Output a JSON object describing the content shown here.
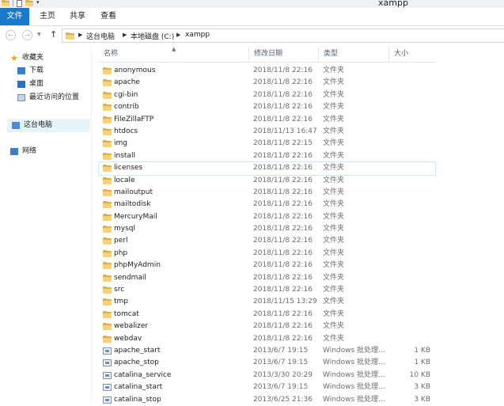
{
  "window": {
    "title": "xampp"
  },
  "ribbon": {
    "tabs": [
      {
        "label": "文件"
      },
      {
        "label": "主页"
      },
      {
        "label": "共享"
      },
      {
        "label": "查看"
      }
    ]
  },
  "address": {
    "crumbs": [
      "这台电脑",
      "本地磁盘 (C:)",
      "xampp"
    ]
  },
  "navpane": {
    "favorites": "收藏夹",
    "downloads": "下载",
    "desktop": "桌面",
    "recent": "最近访问的位置",
    "this_pc": "这台电脑",
    "network": "网络"
  },
  "columns": {
    "name": "名称",
    "date": "修改日期",
    "type": "类型",
    "size": "大小"
  },
  "files": [
    {
      "name": "anonymous",
      "date": "2018/11/8 22:16",
      "type": "文件夹",
      "size": "",
      "kind": "folder"
    },
    {
      "name": "apache",
      "date": "2018/11/8 22:16",
      "type": "文件夹",
      "size": "",
      "kind": "folder"
    },
    {
      "name": "cgi-bin",
      "date": "2018/11/8 22:16",
      "type": "文件夹",
      "size": "",
      "kind": "folder"
    },
    {
      "name": "contrib",
      "date": "2018/11/8 22:16",
      "type": "文件夹",
      "size": "",
      "kind": "folder"
    },
    {
      "name": "FileZillaFTP",
      "date": "2018/11/8 22:16",
      "type": "文件夹",
      "size": "",
      "kind": "folder"
    },
    {
      "name": "htdocs",
      "date": "2018/11/13 16:47",
      "type": "文件夹",
      "size": "",
      "kind": "folder"
    },
    {
      "name": "img",
      "date": "2018/11/8 22:15",
      "type": "文件夹",
      "size": "",
      "kind": "folder"
    },
    {
      "name": "install",
      "date": "2018/11/8 22:16",
      "type": "文件夹",
      "size": "",
      "kind": "folder"
    },
    {
      "name": "licenses",
      "date": "2018/11/8 22:16",
      "type": "文件夹",
      "size": "",
      "kind": "folder",
      "highlight": true
    },
    {
      "name": "locale",
      "date": "2018/11/8 22:16",
      "type": "文件夹",
      "size": "",
      "kind": "folder"
    },
    {
      "name": "mailoutput",
      "date": "2018/11/8 22:16",
      "type": "文件夹",
      "size": "",
      "kind": "folder"
    },
    {
      "name": "mailtodisk",
      "date": "2018/11/8 22:16",
      "type": "文件夹",
      "size": "",
      "kind": "folder"
    },
    {
      "name": "MercuryMail",
      "date": "2018/11/8 22:16",
      "type": "文件夹",
      "size": "",
      "kind": "folder"
    },
    {
      "name": "mysql",
      "date": "2018/11/8 22:16",
      "type": "文件夹",
      "size": "",
      "kind": "folder"
    },
    {
      "name": "perl",
      "date": "2018/11/8 22:16",
      "type": "文件夹",
      "size": "",
      "kind": "folder"
    },
    {
      "name": "php",
      "date": "2018/11/8 22:16",
      "type": "文件夹",
      "size": "",
      "kind": "folder"
    },
    {
      "name": "phpMyAdmin",
      "date": "2018/11/8 22:16",
      "type": "文件夹",
      "size": "",
      "kind": "folder"
    },
    {
      "name": "sendmail",
      "date": "2018/11/8 22:16",
      "type": "文件夹",
      "size": "",
      "kind": "folder"
    },
    {
      "name": "src",
      "date": "2018/11/8 22:16",
      "type": "文件夹",
      "size": "",
      "kind": "folder"
    },
    {
      "name": "tmp",
      "date": "2018/11/15 13:29",
      "type": "文件夹",
      "size": "",
      "kind": "folder"
    },
    {
      "name": "tomcat",
      "date": "2018/11/8 22:16",
      "type": "文件夹",
      "size": "",
      "kind": "folder"
    },
    {
      "name": "webalizer",
      "date": "2018/11/8 22:16",
      "type": "文件夹",
      "size": "",
      "kind": "folder"
    },
    {
      "name": "webdav",
      "date": "2018/11/8 22:16",
      "type": "文件夹",
      "size": "",
      "kind": "folder"
    },
    {
      "name": "apache_start",
      "date": "2013/6/7 19:15",
      "type": "Windows 批处理...",
      "size": "1 KB",
      "kind": "bat"
    },
    {
      "name": "apache_stop",
      "date": "2013/6/7 19:15",
      "type": "Windows 批处理...",
      "size": "1 KB",
      "kind": "bat"
    },
    {
      "name": "catalina_service",
      "date": "2013/3/30 20:29",
      "type": "Windows 批处理...",
      "size": "10 KB",
      "kind": "bat"
    },
    {
      "name": "catalina_start",
      "date": "2013/6/7 19:15",
      "type": "Windows 批处理...",
      "size": "3 KB",
      "kind": "bat"
    },
    {
      "name": "catalina_stop",
      "date": "2013/6/25 21:36",
      "type": "Windows 批处理...",
      "size": "3 KB",
      "kind": "bat"
    }
  ]
}
